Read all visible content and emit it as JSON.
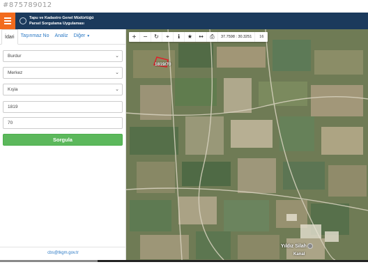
{
  "watermark": "#875789012",
  "header": {
    "title_line1": "Tapu ve Kadastro Genel Müdürlüğü",
    "title_line2": "Parsel Sorgulama Uygulaması"
  },
  "tabs": [
    {
      "label": "İdari",
      "active": true
    },
    {
      "label": "Taşınmaz No",
      "active": false
    },
    {
      "label": "Analiz",
      "active": false
    },
    {
      "label": "Diğer",
      "active": false
    }
  ],
  "form": {
    "il": "Burdur",
    "ilce": "Merkez",
    "mahalle": "Kışla",
    "ada": "1819",
    "parsel": "70",
    "submit_label": "Sorgula"
  },
  "footer": {
    "email": "cbs@tkgm.gov.tr"
  },
  "map": {
    "coordinates": "37.7598 : 30.3251",
    "zoom": "16",
    "parcel_label": "1819/70",
    "place_label": "Yıldız Silah",
    "place_label_2": "Kanal"
  },
  "colors": {
    "header_bg": "#1b3a5c",
    "menu_button": "#f26b1d",
    "submit_button": "#5cb85c",
    "link": "#2a78c4",
    "parcel_outline": "#e0202a"
  }
}
